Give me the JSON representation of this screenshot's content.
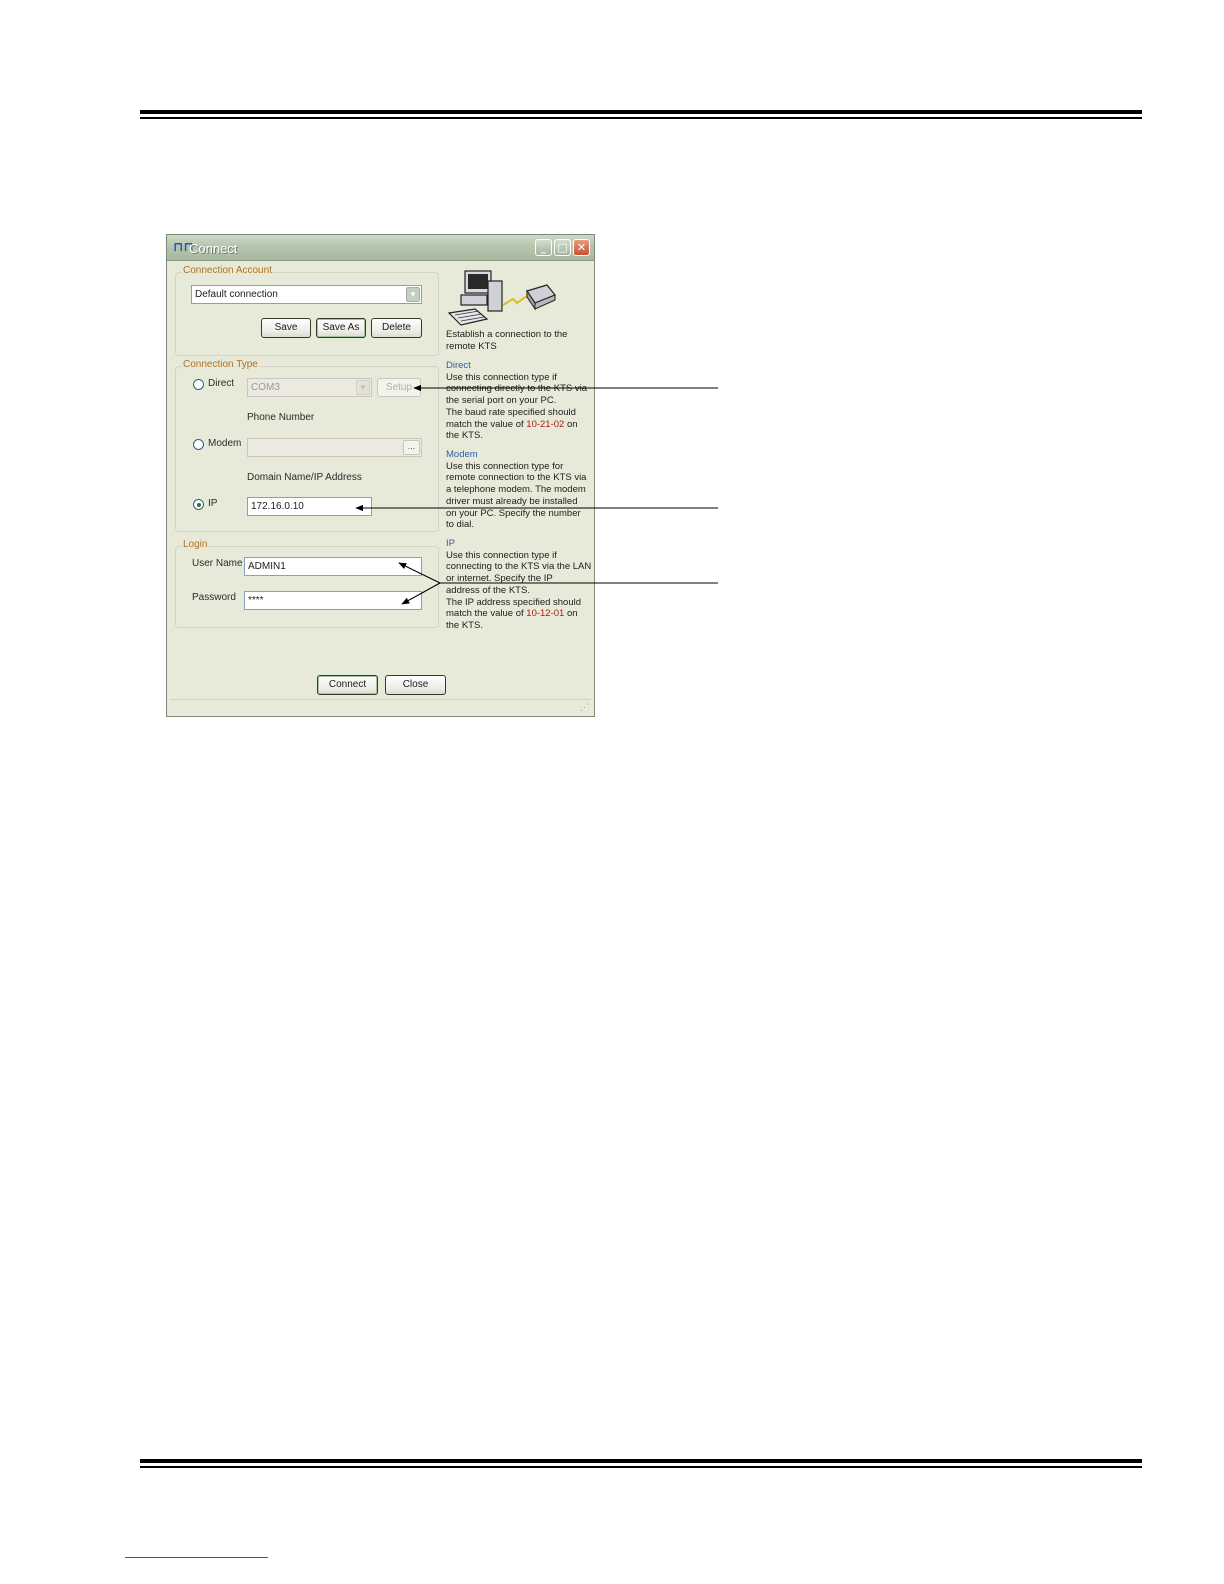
{
  "window": {
    "title": "Connect",
    "app_icon": "app-icon",
    "caption_buttons": {
      "minimize": "_",
      "maximize": "□",
      "close": "✕"
    }
  },
  "connection_account": {
    "legend": "Connection Account",
    "selected": "Default connection",
    "buttons": {
      "save": "Save",
      "save_as": "Save As",
      "delete": "Delete"
    }
  },
  "connection_type": {
    "legend": "Connection Type",
    "direct": {
      "label": "Direct",
      "port_value": "COM3",
      "setup_label": "Setup",
      "selected": false
    },
    "phone_number_label": "Phone Number",
    "modem": {
      "label": "Modem",
      "value": "",
      "browse_label": "...",
      "selected": false
    },
    "domain_label": "Domain Name/IP Address",
    "ip": {
      "label": "IP",
      "value": "172.16.0.10",
      "selected": true
    }
  },
  "login": {
    "legend": "Login",
    "user_name_label": "User Name",
    "user_name_value": "ADMIN1",
    "password_label": "Password",
    "password_value": "****"
  },
  "help_panel": {
    "intro": [
      "Establish a connection to the",
      "remote KTS"
    ],
    "direct": {
      "heading": "Direct",
      "lines": [
        "Use this connection type if",
        "connecting directly to the KTS via",
        "the serial port on your PC.",
        "The baud rate specified should"
      ],
      "match_prefix": "match the value of ",
      "match_code": "10-21-02",
      "match_suffix": " on",
      "last": "the KTS."
    },
    "modem": {
      "heading": "Modem",
      "lines": [
        "Use this connection type for",
        "remote connection to the KTS via",
        "a telephone modem. The modem",
        "driver must already be installed",
        "on your PC. Specify the number",
        "to dial."
      ]
    },
    "ip": {
      "heading": "IP",
      "lines": [
        "Use this connection type if",
        "connecting to the KTS via the LAN",
        "or internet. Specify the IP",
        "address of the KTS.",
        "The IP address specified should"
      ],
      "match_prefix": "match the value of ",
      "match_code": "10-12-01",
      "match_suffix": " on",
      "last": "the KTS."
    }
  },
  "footer_buttons": {
    "connect": "Connect",
    "close": "Close"
  },
  "colors": {
    "title_bar": "#b6c5ae",
    "group_label": "#b27022",
    "help_heading": "#2d5fa8",
    "help_code": "#b01818",
    "window_bg": "#e7ead8"
  }
}
